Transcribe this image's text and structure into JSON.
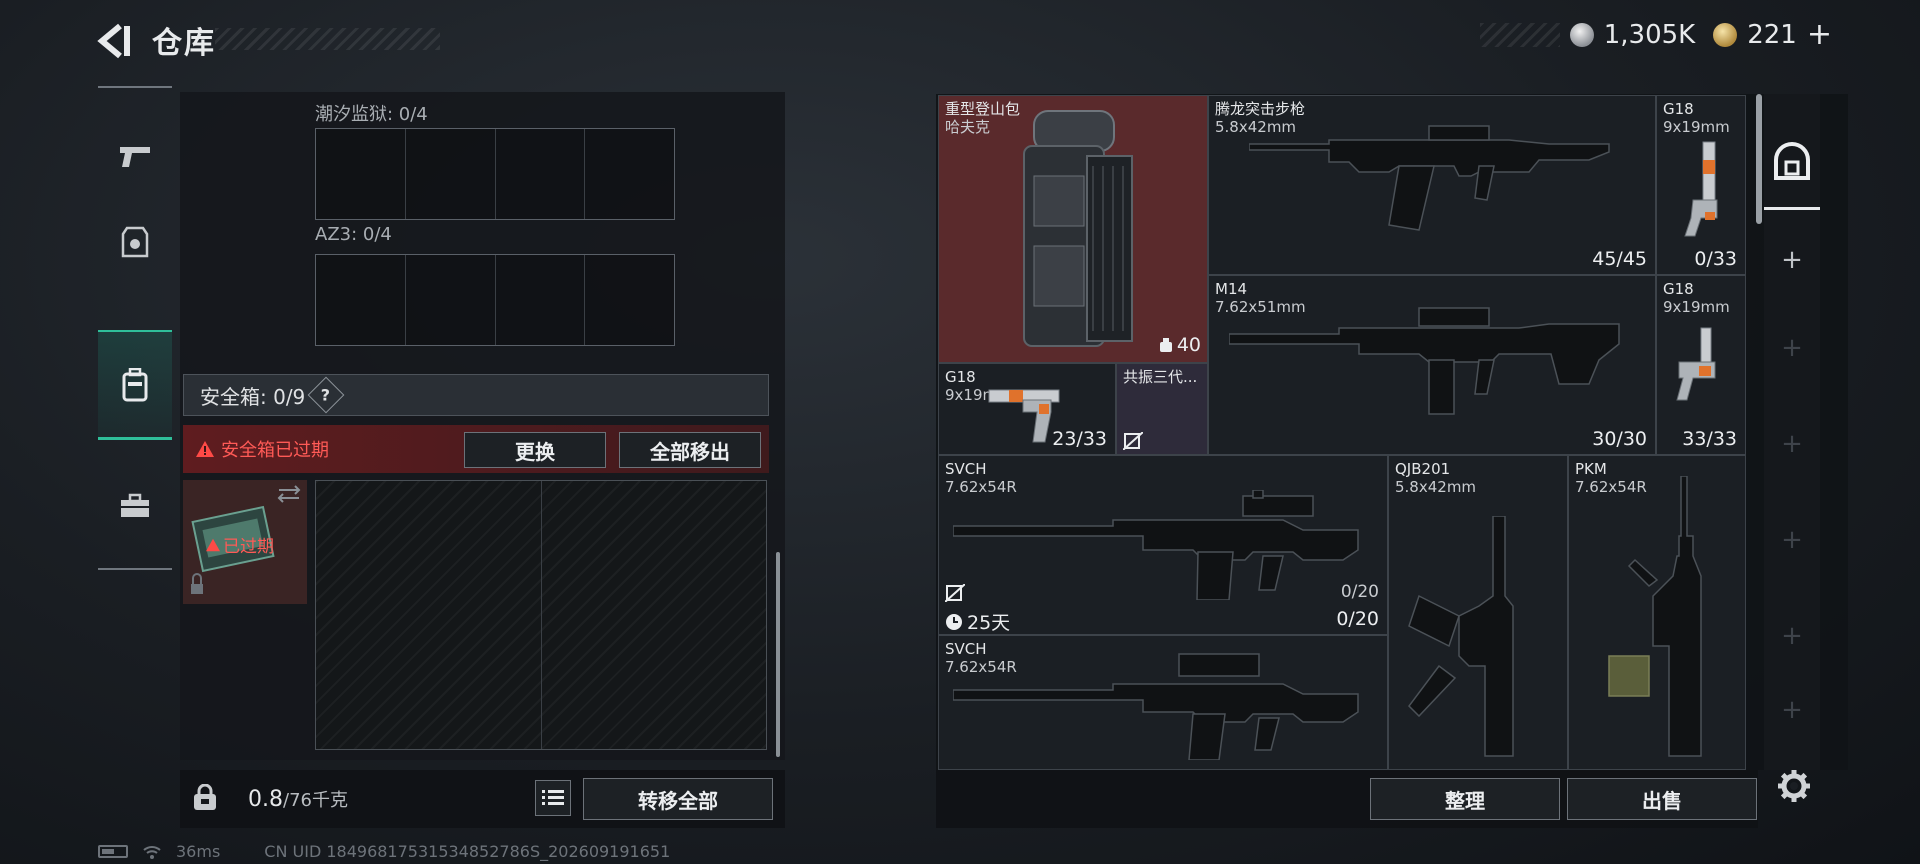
{
  "header": {
    "title": "仓库",
    "currency_1": "1,305K",
    "currency_2": "221",
    "currency_plus": "+"
  },
  "side_nav": {
    "items": [
      {
        "name": "weapons"
      },
      {
        "name": "equipment"
      },
      {
        "name": "backpack"
      },
      {
        "name": "case"
      }
    ]
  },
  "left_panel": {
    "tidal_prison_label": "潮汐监狱: 0/4",
    "az3_label": "AZ3: 0/4",
    "safebox_label": "安全箱: 0/9",
    "safebox_help": "?",
    "expired_warning": "安全箱已过期",
    "replace_button": "更换",
    "remove_all_button": "全部移出",
    "thumb_expired": "已过期",
    "weight_value": "0.8",
    "weight_capacity": "/76千克",
    "transfer_all_button": "转移全部"
  },
  "inventory": [
    {
      "id": "backpack",
      "name": "重型登山包",
      "sub": "哈夫克",
      "count": "40"
    },
    {
      "id": "rifle1",
      "name": "腾龙突击步枪",
      "sub": "5.8x42mm",
      "count": "45/45"
    },
    {
      "id": "g18a",
      "name": "G18",
      "sub": "9x19mm",
      "count": "0/33"
    },
    {
      "id": "m14",
      "name": "M14",
      "sub": "7.62x51mm",
      "count": "30/30"
    },
    {
      "id": "g18b",
      "name": "G18",
      "sub": "9x19mm",
      "count": "33/33"
    },
    {
      "id": "g18c",
      "name": "G18",
      "sub": "9x19mm",
      "count": "23/33"
    },
    {
      "id": "resonance",
      "name": "共振三代..."
    },
    {
      "id": "svch1",
      "name": "SVCH",
      "sub": "7.62x54R",
      "count": "0/20",
      "count_top": "0/20",
      "timer": "25天"
    },
    {
      "id": "qjb201",
      "name": "QJB201",
      "sub": "5.8x42mm"
    },
    {
      "id": "pkm",
      "name": "PKM",
      "sub": "7.62x54R"
    },
    {
      "id": "svch2",
      "name": "SVCH",
      "sub": "7.62x54R"
    }
  ],
  "actions": {
    "sort_button": "整理",
    "sell_button": "出售"
  },
  "footer": {
    "ping": "36ms",
    "uid": "CN UID 18496817531534852786S_202609191651"
  }
}
